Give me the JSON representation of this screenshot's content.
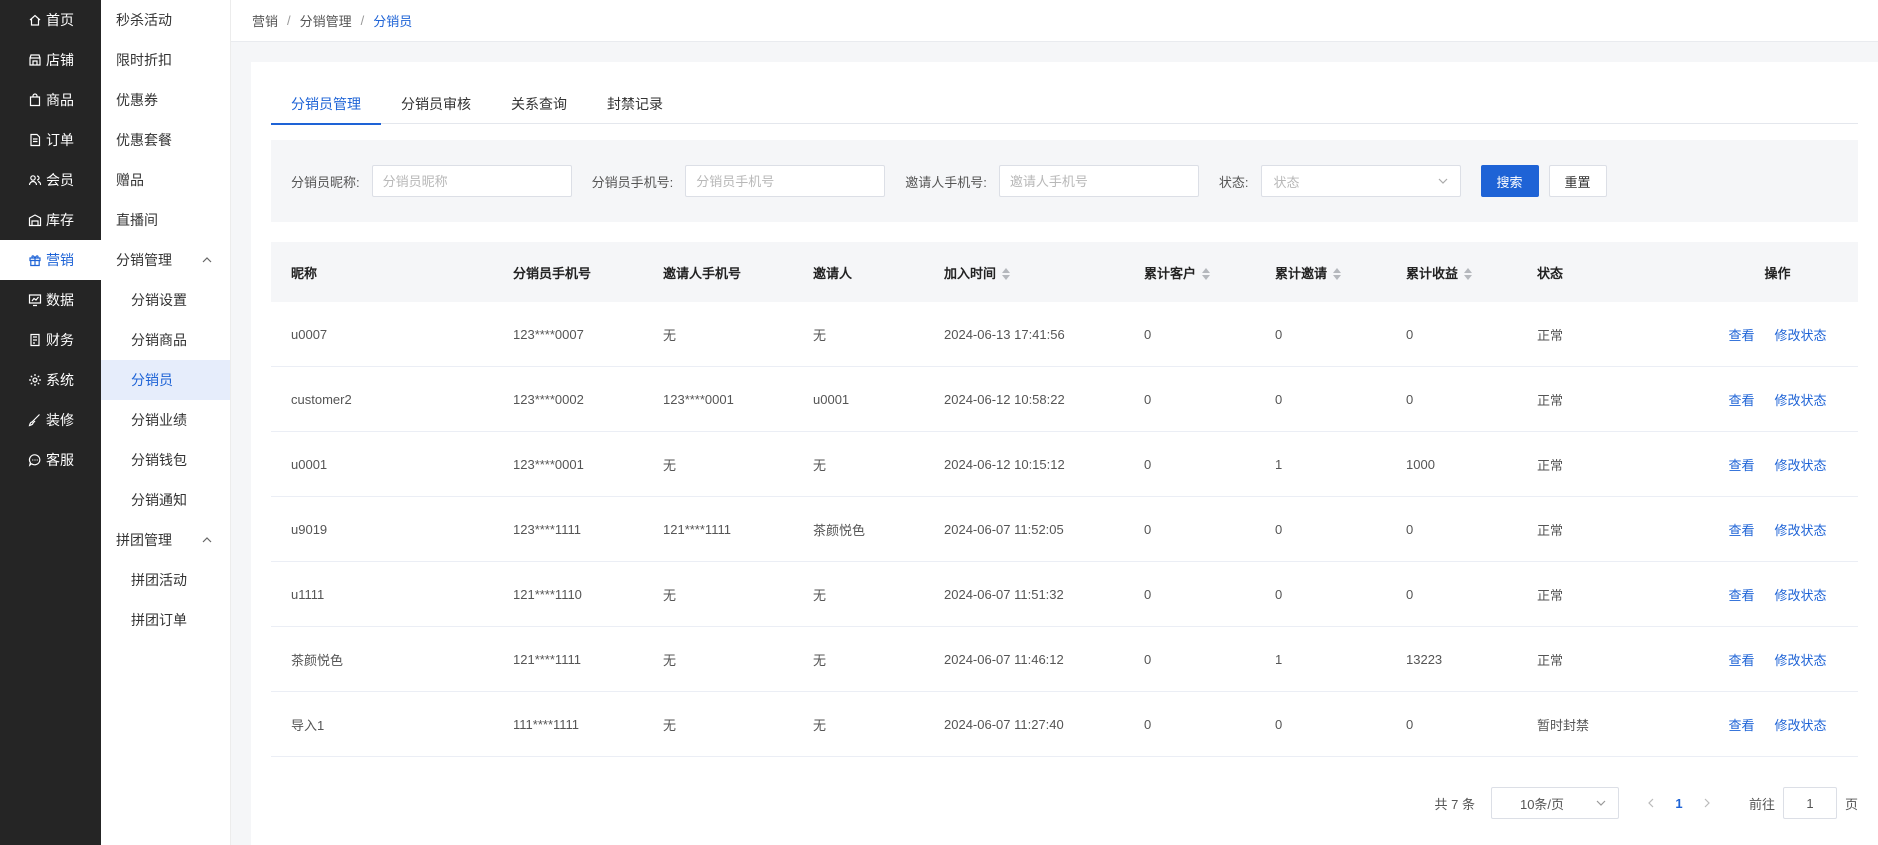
{
  "nav": {
    "items": [
      {
        "label": "首页",
        "icon": "home-icon"
      },
      {
        "label": "店铺",
        "icon": "store-icon"
      },
      {
        "label": "商品",
        "icon": "bag-icon"
      },
      {
        "label": "订单",
        "icon": "document-icon"
      },
      {
        "label": "会员",
        "icon": "users-icon"
      },
      {
        "label": "库存",
        "icon": "warehouse-icon"
      },
      {
        "label": "营销",
        "icon": "gift-icon",
        "active": true
      },
      {
        "label": "数据",
        "icon": "chart-icon"
      },
      {
        "label": "财务",
        "icon": "finance-icon"
      },
      {
        "label": "系统",
        "icon": "gear-icon"
      },
      {
        "label": "装修",
        "icon": "brush-icon"
      },
      {
        "label": "客服",
        "icon": "chat-icon"
      }
    ]
  },
  "submenu": {
    "items": [
      {
        "label": "秒杀活动",
        "type": "item"
      },
      {
        "label": "限时折扣",
        "type": "item"
      },
      {
        "label": "优惠券",
        "type": "item"
      },
      {
        "label": "优惠套餐",
        "type": "item"
      },
      {
        "label": "赠品",
        "type": "item"
      },
      {
        "label": "直播间",
        "type": "item"
      },
      {
        "label": "分销管理",
        "type": "group"
      },
      {
        "label": "分销设置",
        "type": "child"
      },
      {
        "label": "分销商品",
        "type": "child"
      },
      {
        "label": "分销员",
        "type": "child",
        "selected": true
      },
      {
        "label": "分销业绩",
        "type": "child"
      },
      {
        "label": "分销钱包",
        "type": "child"
      },
      {
        "label": "分销通知",
        "type": "child"
      },
      {
        "label": "拼团管理",
        "type": "group"
      },
      {
        "label": "拼团活动",
        "type": "child"
      },
      {
        "label": "拼团订单",
        "type": "child"
      }
    ]
  },
  "breadcrumb": [
    "营销",
    "分销管理",
    "分销员"
  ],
  "tabs": [
    "分销员管理",
    "分销员审核",
    "关系查询",
    "封禁记录"
  ],
  "filter": {
    "nickname_label": "分销员昵称:",
    "nickname_placeholder": "分销员昵称",
    "phone_label": "分销员手机号:",
    "phone_placeholder": "分销员手机号",
    "inviter_phone_label": "邀请人手机号:",
    "inviter_phone_placeholder": "邀请人手机号",
    "status_label": "状态:",
    "status_placeholder": "状态",
    "search_label": "搜索",
    "reset_label": "重置"
  },
  "table": {
    "headers": [
      "昵称",
      "分销员手机号",
      "邀请人手机号",
      "邀请人",
      "加入时间",
      "累计客户",
      "累计邀请",
      "累计收益",
      "状态",
      "操作"
    ],
    "view_label": "查看",
    "edit_label": "修改状态",
    "rows": [
      [
        "u0007",
        "123****0007",
        "无",
        "无",
        "2024-06-13 17:41:56",
        "0",
        "0",
        "0",
        "正常"
      ],
      [
        "customer2",
        "123****0002",
        "123****0001",
        "u0001",
        "2024-06-12 10:58:22",
        "0",
        "0",
        "0",
        "正常"
      ],
      [
        "u0001",
        "123****0001",
        "无",
        "无",
        "2024-06-12 10:15:12",
        "0",
        "1",
        "1000",
        "正常"
      ],
      [
        "u9019",
        "123****1111",
        "121****1111",
        "茶颜悦色",
        "2024-06-07 11:52:05",
        "0",
        "0",
        "0",
        "正常"
      ],
      [
        "u1111",
        "121****1110",
        "无",
        "无",
        "2024-06-07 11:51:32",
        "0",
        "0",
        "0",
        "正常"
      ],
      [
        "茶颜悦色",
        "121****1111",
        "无",
        "无",
        "2024-06-07 11:46:12",
        "0",
        "1",
        "13223",
        "正常"
      ],
      [
        "导入1",
        "111****1111",
        "无",
        "无",
        "2024-06-07 11:27:40",
        "0",
        "0",
        "0",
        "暂时封禁"
      ]
    ]
  },
  "pager": {
    "total": "共 7 条",
    "page_size": "10条/页",
    "current": "1",
    "goto_label": "前往",
    "goto_value": "1",
    "page_suffix": "页"
  }
}
